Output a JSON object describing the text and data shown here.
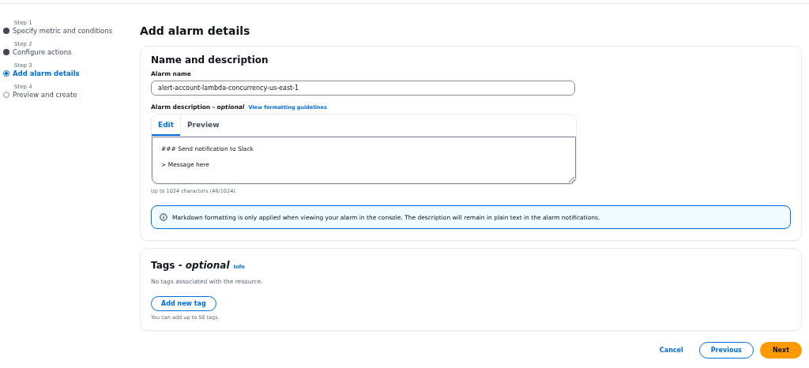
{
  "steps": [
    {
      "label": "Step 1",
      "title": "Specify metric and conditions",
      "completed": true,
      "current": false
    },
    {
      "label": "Step 2",
      "title": "Configure actions",
      "completed": true,
      "current": false
    },
    {
      "label": "Step 3",
      "title": "Add alarm details",
      "completed": false,
      "current": true
    },
    {
      "label": "Step 4",
      "title": "Preview and create",
      "completed": false,
      "current": false
    }
  ],
  "page_title": "Add alarm details",
  "name_section": {
    "title": "Name and description",
    "name_label": "Alarm name",
    "name_value": "alert-account-lambda-concurrency-us-east-1",
    "description_label": "Alarm description - *optional*",
    "guidelines_link": "View formatting guidelines",
    "tabs": [
      {
        "label": "Edit",
        "selected": true
      },
      {
        "label": "Preview",
        "selected": false
      }
    ],
    "description_lines": [
      "### Send notification to Slack",
      "> Message here"
    ],
    "hint": "Up to 1024 characters (46/1024).",
    "info_alert": "Markdown formatting is only applied when viewing your alarm in the console. The description will remain in plain text in the alarm notifications."
  },
  "tags_section": {
    "title": "Tags - *optional*",
    "info_link": "Info",
    "empty_text": "No tags associated with the resource.",
    "add_button": "Add new tag",
    "hint": "You can add up to 50 tags."
  },
  "footer": {
    "cancel": "Cancel",
    "previous": "Previous",
    "next": "Next"
  }
}
